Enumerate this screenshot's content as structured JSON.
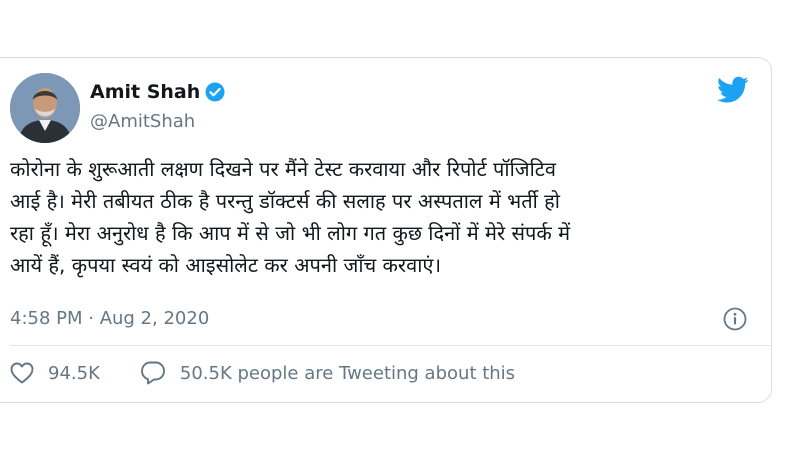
{
  "user": {
    "display_name": "Amit Shah",
    "handle": "@AmitShah",
    "verified": true,
    "avatar_icon": "profile-photo"
  },
  "tweet": {
    "text": "कोरोना के शुरूआती लक्षण दिखने पर मैंने टेस्ट करवाया और रिपोर्ट पॉजिटिव\nआई है। मेरी तबीयत ठीक है परन्तु डॉक्टर्स की सलाह पर अस्पताल में भर्ती हो\nरहा हूँ। मेरा अनुरोध है कि आप में से जो भी लोग गत कुछ दिनों में मेरे संपर्क में\nआयें हैं, कृपया स्वयं को आइसोलेट कर अपनी जाँच करवाएं।",
    "timestamp": "4:58 PM · Aug 2, 2020"
  },
  "stats": {
    "likes": "94.5K",
    "replies_text": "50.5K people are Tweeting about this"
  },
  "icons": {
    "brand": "twitter-bird-icon",
    "info": "info-icon",
    "like": "heart-icon",
    "reply": "speech-bubble-icon"
  },
  "colors": {
    "brand_blue": "#1da1f2",
    "text": "#14171a",
    "secondary": "#657786"
  }
}
